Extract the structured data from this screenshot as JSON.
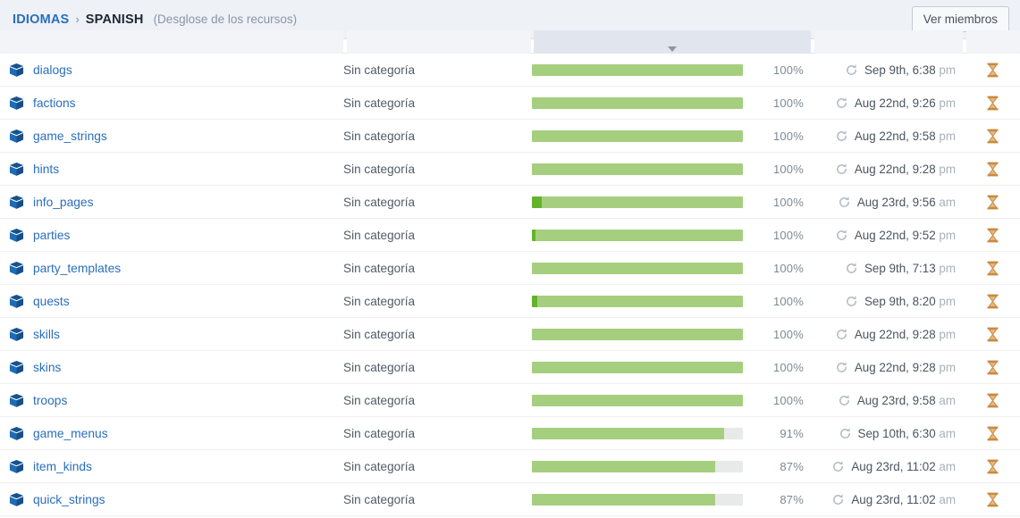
{
  "topbar": {
    "breadcrumb": {
      "root_label": "IDIOMAS",
      "separator": "›",
      "current_label": "SPANISH",
      "note": "(Desglose de los recursos)"
    },
    "members_button_label": "Ver miembros"
  },
  "table": {
    "sorted_column_index": 2,
    "colors": {
      "bar_translated": "#a5cf7e",
      "bar_approved": "#64b32c",
      "bar_empty": "#e8e9e9",
      "link": "#2a6ebb",
      "hourglass": "#d79a4e"
    },
    "icons": {
      "row_icon": "package-cube-icon",
      "date_icon": "refresh-icon",
      "status_icon": "hourglass-icon",
      "sort_icon": "sort-descending-caret-icon"
    },
    "rows": [
      {
        "name": "dialogs",
        "category": "Sin categoría",
        "approved_pct": 0,
        "translated_pct": 100,
        "percent": "100%",
        "date": "Sep 9th, 6:38 ",
        "meridiem": "pm"
      },
      {
        "name": "factions",
        "category": "Sin categoría",
        "approved_pct": 0,
        "translated_pct": 100,
        "percent": "100%",
        "date": "Aug 22nd, 9:26 ",
        "meridiem": "pm"
      },
      {
        "name": "game_strings",
        "category": "Sin categoría",
        "approved_pct": 0,
        "translated_pct": 100,
        "percent": "100%",
        "date": "Aug 22nd, 9:58 ",
        "meridiem": "pm"
      },
      {
        "name": "hints",
        "category": "Sin categoría",
        "approved_pct": 0,
        "translated_pct": 100,
        "percent": "100%",
        "date": "Aug 22nd, 9:28 ",
        "meridiem": "pm"
      },
      {
        "name": "info_pages",
        "category": "Sin categoría",
        "approved_pct": 4.5,
        "translated_pct": 100,
        "percent": "100%",
        "date": "Aug 23rd, 9:56 ",
        "meridiem": "am"
      },
      {
        "name": "parties",
        "category": "Sin categoría",
        "approved_pct": 1.5,
        "translated_pct": 100,
        "percent": "100%",
        "date": "Aug 22nd, 9:52 ",
        "meridiem": "pm"
      },
      {
        "name": "party_templates",
        "category": "Sin categoría",
        "approved_pct": 0,
        "translated_pct": 100,
        "percent": "100%",
        "date": "Sep 9th, 7:13 ",
        "meridiem": "pm"
      },
      {
        "name": "quests",
        "category": "Sin categoría",
        "approved_pct": 2.5,
        "translated_pct": 100,
        "percent": "100%",
        "date": "Sep 9th, 8:20 ",
        "meridiem": "pm"
      },
      {
        "name": "skills",
        "category": "Sin categoría",
        "approved_pct": 0,
        "translated_pct": 100,
        "percent": "100%",
        "date": "Aug 22nd, 9:28 ",
        "meridiem": "pm"
      },
      {
        "name": "skins",
        "category": "Sin categoría",
        "approved_pct": 0,
        "translated_pct": 100,
        "percent": "100%",
        "date": "Aug 22nd, 9:28 ",
        "meridiem": "pm"
      },
      {
        "name": "troops",
        "category": "Sin categoría",
        "approved_pct": 0,
        "translated_pct": 100,
        "percent": "100%",
        "date": "Aug 23rd, 9:58 ",
        "meridiem": "am"
      },
      {
        "name": "game_menus",
        "category": "Sin categoría",
        "approved_pct": 0,
        "translated_pct": 91,
        "percent": "91%",
        "date": "Sep 10th, 6:30 ",
        "meridiem": "am"
      },
      {
        "name": "item_kinds",
        "category": "Sin categoría",
        "approved_pct": 0,
        "translated_pct": 87,
        "percent": "87%",
        "date": "Aug 23rd, 11:02 ",
        "meridiem": "am"
      },
      {
        "name": "quick_strings",
        "category": "Sin categoría",
        "approved_pct": 0,
        "translated_pct": 87,
        "percent": "87%",
        "date": "Aug 23rd, 11:02 ",
        "meridiem": "am"
      }
    ]
  }
}
